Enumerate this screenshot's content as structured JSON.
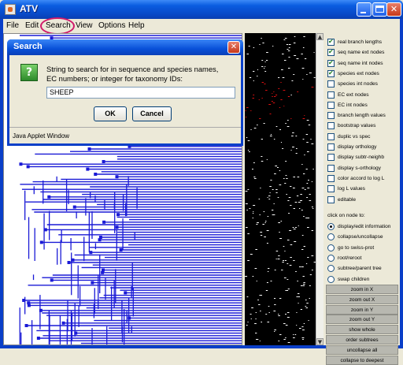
{
  "window": {
    "title": "ATV"
  },
  "menu": {
    "items": [
      "File",
      "Edit",
      "Search",
      "View",
      "Options",
      "Help"
    ]
  },
  "dialog": {
    "title": "Search",
    "message_line1": "String to search for in sequence and species names,",
    "message_line2": "EC numbers; or integer for taxonomy IDs:",
    "input_value": "SHEEP",
    "ok_label": "OK",
    "cancel_label": "Cancel",
    "status_text": "Java Applet Window",
    "icon": "question-icon"
  },
  "controls": {
    "checkboxes": [
      {
        "label": "real branch lengths",
        "checked": true
      },
      {
        "label": "seq name ext nodes",
        "checked": true
      },
      {
        "label": "seq name int nodes",
        "checked": true
      },
      {
        "label": "species ext nodes",
        "checked": true
      },
      {
        "label": "species int nodes",
        "checked": false
      },
      {
        "label": "EC ext nodes",
        "checked": false
      },
      {
        "label": "EC int nodes",
        "checked": false
      },
      {
        "label": "branch length values",
        "checked": false
      },
      {
        "label": "bootstrap values",
        "checked": false
      },
      {
        "label": "duplic vs spec",
        "checked": false
      },
      {
        "label": "display orthology",
        "checked": false
      },
      {
        "label": "display subtr-neighb",
        "checked": false
      },
      {
        "label": "display s-orthology",
        "checked": false
      },
      {
        "label": "color accord to log L",
        "checked": false
      },
      {
        "label": "log L values",
        "checked": false
      },
      {
        "label": "editable",
        "checked": false
      }
    ],
    "click_label": "click on node to:",
    "radios": [
      {
        "label": "display/edit information",
        "selected": true
      },
      {
        "label": "collapse/uncollapse",
        "selected": false
      },
      {
        "label": "go to swiss-prot",
        "selected": false
      },
      {
        "label": "root/reroot",
        "selected": false
      },
      {
        "label": "subtree/parent tree",
        "selected": false
      },
      {
        "label": "swap children",
        "selected": false
      }
    ],
    "buttons": [
      "zoom in X",
      "zoom out X",
      "zoom in Y",
      "zoom out Y",
      "show whole",
      "order subtrees",
      "uncollapse all",
      "collapse to deepest"
    ]
  },
  "colors": {
    "tree": "#1a1ad6",
    "highlight": "#e01010",
    "annotation_ring": "#d01a6a"
  }
}
